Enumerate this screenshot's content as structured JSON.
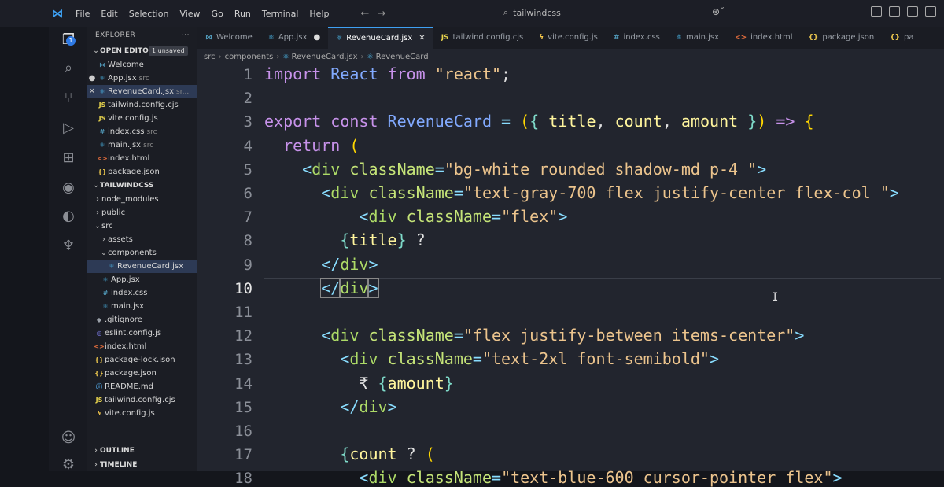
{
  "menu": [
    "File",
    "Edit",
    "Selection",
    "View",
    "Go",
    "Run",
    "Terminal",
    "Help"
  ],
  "search": {
    "placeholder": "tailwindcss"
  },
  "explorer": {
    "title": "EXPLORER",
    "open_editors_label": "OPEN EDITORS",
    "unsaved_badge": "1 unsaved",
    "open_editors": [
      {
        "name": "Welcome",
        "desc": "",
        "icon": "vscode-icon",
        "mark": ""
      },
      {
        "name": "App.jsx",
        "desc": "src",
        "icon": "react-icon",
        "mark": "●"
      },
      {
        "name": "RevenueCard.jsx",
        "desc": "sr...",
        "icon": "react-icon",
        "mark": "✕"
      },
      {
        "name": "tailwind.config.cjs",
        "desc": "",
        "icon": "js-icon",
        "mark": ""
      },
      {
        "name": "vite.config.js",
        "desc": "",
        "icon": "js-icon",
        "mark": ""
      },
      {
        "name": "index.css",
        "desc": "src",
        "icon": "css-icon",
        "mark": ""
      },
      {
        "name": "main.jsx",
        "desc": "src",
        "icon": "react-icon",
        "mark": ""
      },
      {
        "name": "index.html",
        "desc": "",
        "icon": "html-icon",
        "mark": ""
      },
      {
        "name": "package.json",
        "desc": "",
        "icon": "json-icon",
        "mark": ""
      }
    ],
    "project_label": "TAILWINDCSS",
    "tree": [
      {
        "name": "node_modules",
        "indent": 1,
        "type": "folder"
      },
      {
        "name": "public",
        "indent": 1,
        "type": "folder"
      },
      {
        "name": "src",
        "indent": 1,
        "type": "folder-open"
      },
      {
        "name": "assets",
        "indent": 2,
        "type": "folder"
      },
      {
        "name": "components",
        "indent": 2,
        "type": "folder-open"
      },
      {
        "name": "RevenueCard.jsx",
        "indent": 3,
        "type": "react"
      },
      {
        "name": "App.jsx",
        "indent": 2,
        "type": "react"
      },
      {
        "name": "index.css",
        "indent": 2,
        "type": "css"
      },
      {
        "name": "main.jsx",
        "indent": 2,
        "type": "react"
      },
      {
        "name": ".gitignore",
        "indent": 1,
        "type": "git"
      },
      {
        "name": "eslint.config.js",
        "indent": 1,
        "type": "eslint"
      },
      {
        "name": "index.html",
        "indent": 1,
        "type": "html"
      },
      {
        "name": "package-lock.json",
        "indent": 1,
        "type": "json"
      },
      {
        "name": "package.json",
        "indent": 1,
        "type": "json"
      },
      {
        "name": "README.md",
        "indent": 1,
        "type": "info"
      },
      {
        "name": "tailwind.config.cjs",
        "indent": 1,
        "type": "js"
      },
      {
        "name": "vite.config.js",
        "indent": 1,
        "type": "vite"
      }
    ],
    "outline_label": "OUTLINE",
    "timeline_label": "TIMELINE"
  },
  "tabs": [
    {
      "label": "Welcome",
      "icon": "vscode-icon",
      "state": ""
    },
    {
      "label": "App.jsx",
      "icon": "react-icon",
      "state": "●"
    },
    {
      "label": "RevenueCard.jsx",
      "icon": "react-icon",
      "state": "✕",
      "active": true
    },
    {
      "label": "tailwind.config.cjs",
      "icon": "js-icon",
      "state": ""
    },
    {
      "label": "vite.config.js",
      "icon": "vite-icon",
      "state": ""
    },
    {
      "label": "index.css",
      "icon": "css-icon",
      "state": ""
    },
    {
      "label": "main.jsx",
      "icon": "react-icon",
      "state": ""
    },
    {
      "label": "index.html",
      "icon": "html-icon",
      "state": ""
    },
    {
      "label": "package.json",
      "icon": "json-icon",
      "state": ""
    },
    {
      "label": "pa",
      "icon": "json-icon",
      "state": ""
    }
  ],
  "breadcrumb": [
    "src",
    "components",
    "RevenueCard.jsx",
    "RevenueCard"
  ],
  "editor": {
    "current_line": 10,
    "lines": [
      {
        "n": "1",
        "tokens": [
          [
            "kw",
            "import "
          ],
          [
            "blue",
            "React "
          ],
          [
            "kw",
            "from "
          ],
          [
            "str",
            "\"react\""
          ],
          [
            "plain",
            ";"
          ]
        ]
      },
      {
        "n": "2",
        "tokens": []
      },
      {
        "n": "3",
        "tokens": [
          [
            "kw",
            "export "
          ],
          [
            "kw",
            "const "
          ],
          [
            "blue",
            "RevenueCard "
          ],
          [
            "punc",
            "= "
          ],
          [
            "brace",
            "("
          ],
          [
            "jsx",
            "{ "
          ],
          [
            "var",
            "title"
          ],
          [
            "plain",
            ", "
          ],
          [
            "var",
            "count"
          ],
          [
            "plain",
            ", "
          ],
          [
            "var",
            "amount "
          ],
          [
            "jsx",
            "}"
          ],
          [
            "brace",
            ")"
          ],
          [
            "kw",
            " => "
          ],
          [
            "brace",
            "{"
          ]
        ]
      },
      {
        "n": "4",
        "tokens": [
          [
            "plain",
            "  "
          ],
          [
            "kw",
            "return "
          ],
          [
            "brace",
            "("
          ]
        ]
      },
      {
        "n": "5",
        "tokens": [
          [
            "plain",
            "    "
          ],
          [
            "punc",
            "<"
          ],
          [
            "tag",
            "div "
          ],
          [
            "attr",
            "className"
          ],
          [
            "punc",
            "="
          ],
          [
            "str",
            "\"bg-white rounded shadow-md p-4 \""
          ],
          [
            "punc",
            ">"
          ]
        ]
      },
      {
        "n": "6",
        "tokens": [
          [
            "plain",
            "      "
          ],
          [
            "punc",
            "<"
          ],
          [
            "tag",
            "div "
          ],
          [
            "attr",
            "className"
          ],
          [
            "punc",
            "="
          ],
          [
            "str",
            "\"text-gray-700 flex justify-center flex-col \""
          ],
          [
            "punc",
            ">"
          ]
        ]
      },
      {
        "n": "7",
        "tokens": [
          [
            "plain",
            "          "
          ],
          [
            "punc",
            "<"
          ],
          [
            "tag",
            "div "
          ],
          [
            "attr",
            "className"
          ],
          [
            "punc",
            "="
          ],
          [
            "str",
            "\"flex\""
          ],
          [
            "punc",
            ">"
          ]
        ]
      },
      {
        "n": "8",
        "tokens": [
          [
            "plain",
            "        "
          ],
          [
            "jsx",
            "{"
          ],
          [
            "var",
            "title"
          ],
          [
            "jsx",
            "}"
          ],
          [
            "plain",
            " ?"
          ]
        ]
      },
      {
        "n": "9",
        "tokens": [
          [
            "plain",
            "      "
          ],
          [
            "punc",
            "</"
          ],
          [
            "tag",
            "div"
          ],
          [
            "punc",
            ">"
          ]
        ]
      },
      {
        "n": "10",
        "tokens": [
          [
            "plain",
            "      "
          ],
          [
            "punc",
            "</"
          ],
          [
            "tag",
            "div"
          ],
          [
            "punc",
            ">"
          ]
        ]
      },
      {
        "n": "11",
        "tokens": []
      },
      {
        "n": "12",
        "tokens": [
          [
            "plain",
            "      "
          ],
          [
            "punc",
            "<"
          ],
          [
            "tag",
            "div "
          ],
          [
            "attr",
            "className"
          ],
          [
            "punc",
            "="
          ],
          [
            "str",
            "\"flex justify-between items-center\""
          ],
          [
            "punc",
            ">"
          ]
        ]
      },
      {
        "n": "13",
        "tokens": [
          [
            "plain",
            "        "
          ],
          [
            "punc",
            "<"
          ],
          [
            "tag",
            "div "
          ],
          [
            "attr",
            "className"
          ],
          [
            "punc",
            "="
          ],
          [
            "str",
            "\"text-2xl font-semibold\""
          ],
          [
            "punc",
            ">"
          ]
        ]
      },
      {
        "n": "14",
        "tokens": [
          [
            "plain",
            "          ₹ "
          ],
          [
            "jsx",
            "{"
          ],
          [
            "var",
            "amount"
          ],
          [
            "jsx",
            "}"
          ]
        ]
      },
      {
        "n": "15",
        "tokens": [
          [
            "plain",
            "        "
          ],
          [
            "punc",
            "</"
          ],
          [
            "tag",
            "div"
          ],
          [
            "punc",
            ">"
          ]
        ]
      },
      {
        "n": "16",
        "tokens": []
      },
      {
        "n": "17",
        "tokens": [
          [
            "plain",
            "        "
          ],
          [
            "jsx",
            "{"
          ],
          [
            "var",
            "count"
          ],
          [
            "plain",
            " ? "
          ],
          [
            "brace",
            "("
          ]
        ]
      },
      {
        "n": "18",
        "tokens": [
          [
            "plain",
            "          "
          ],
          [
            "punc",
            "<"
          ],
          [
            "tag",
            "div "
          ],
          [
            "attr",
            "className"
          ],
          [
            "punc",
            "="
          ],
          [
            "str",
            "\"text-blue-600 cursor-pointer flex\""
          ],
          [
            "punc",
            ">"
          ]
        ]
      }
    ]
  }
}
